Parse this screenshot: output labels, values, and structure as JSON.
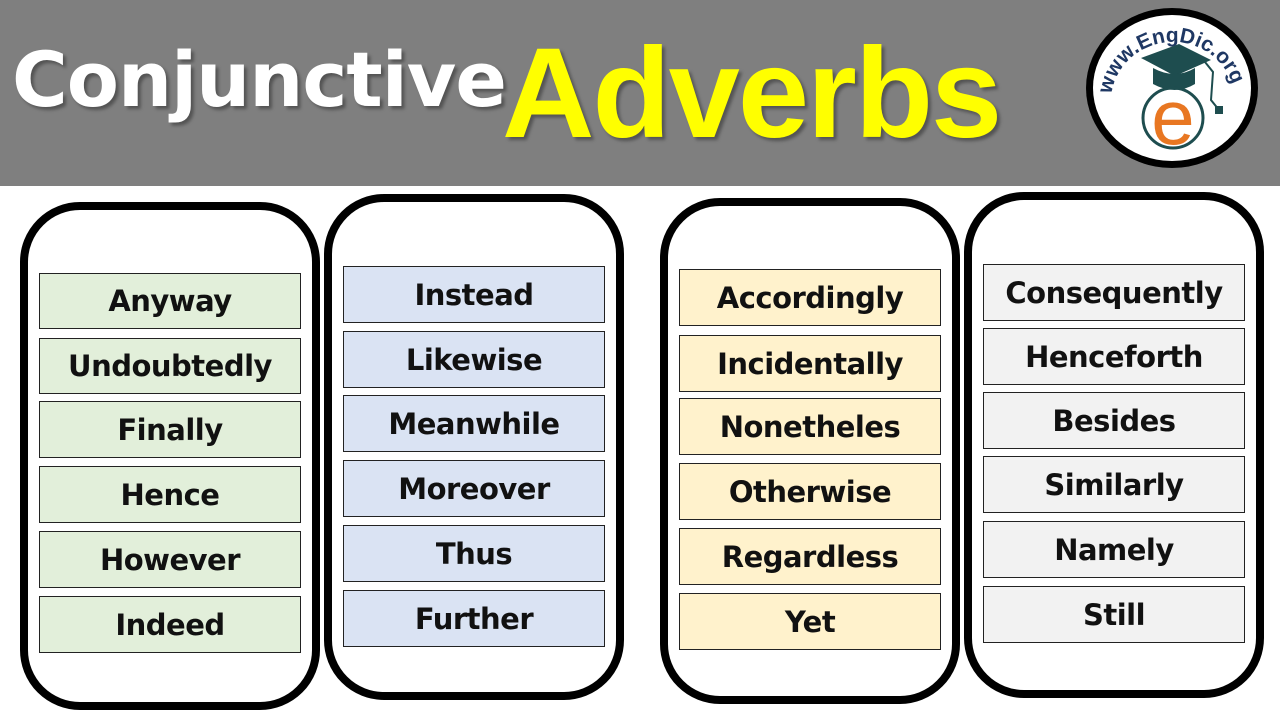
{
  "header": {
    "title_part1": "Conjunctive",
    "title_part2": "Adverbs",
    "colors": {
      "banner": "#7f7f7f",
      "title_part1": "#ffffff",
      "title_part2": "#ffff00"
    }
  },
  "logo": {
    "text": "www.EngDic.org",
    "letter": "e",
    "colors": {
      "text": "#1f3864",
      "cap": "#1e4d4f",
      "letter": "#e87722"
    }
  },
  "columns": [
    {
      "name": "column-1",
      "color": "#e2efda",
      "items": [
        "Anyway",
        "Undoubtedly",
        "Finally",
        "Hence",
        "However",
        "Indeed"
      ]
    },
    {
      "name": "column-2",
      "color": "#dae3f3",
      "items": [
        "Instead",
        "Likewise",
        "Meanwhile",
        "Moreover",
        "Thus",
        "Further"
      ]
    },
    {
      "name": "column-3",
      "color": "#fff2cc",
      "items": [
        "Accordingly",
        "Incidentally",
        "Nonetheles",
        "Otherwise",
        "Regardless",
        "Yet"
      ]
    },
    {
      "name": "column-4",
      "color": "#f2f2f2",
      "items": [
        "Consequently",
        "Henceforth",
        "Besides",
        "Similarly",
        "Namely",
        "Still"
      ]
    }
  ]
}
